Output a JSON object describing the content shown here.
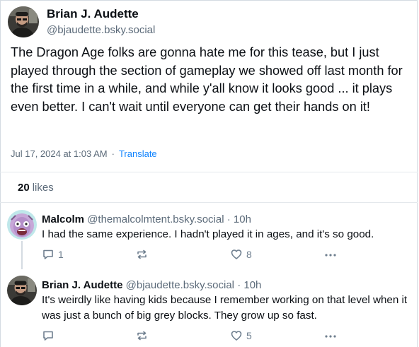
{
  "post": {
    "author_name": "Brian J. Audette",
    "author_handle": "@bjaudette.bsky.social",
    "text": "The Dragon Age folks are gonna hate me for this tease, but I just played through the section of gameplay we showed off last month for the first time in a while, and while y'all know it looks good ... it plays even better. I can't wait until everyone can get their hands on it!",
    "timestamp": "Jul 17, 2024 at 1:03 AM",
    "separator": "·",
    "translate_label": "Translate",
    "likes_count": "20",
    "likes_label": "likes"
  },
  "replies": [
    {
      "author_name": "Malcolm",
      "author_handle": "@themalcolmtent.bsky.social",
      "age": "· 10h",
      "text": "I had the same experience. I hadn't played it in ages, and it's so good.",
      "reply_count": "1",
      "repost_count": "",
      "like_count": "8"
    },
    {
      "author_name": "Brian J. Audette",
      "author_handle": "@bjaudette.bsky.social",
      "age": "· 10h",
      "text": "It's weirdly like having kids because I remember working on that level when it was just a bunch of big grey blocks. They grow up so fast.",
      "reply_count": "",
      "repost_count": "",
      "like_count": "5"
    }
  ],
  "icons": {
    "reply": "speech-bubble-icon",
    "repost": "repost-arrows-icon",
    "like": "heart-icon",
    "more": "ellipsis-icon"
  },
  "colors": {
    "link": "#1083fe",
    "muted": "#5b6a79",
    "icon": "#6f7f8f",
    "divider": "#e4e8ec"
  }
}
